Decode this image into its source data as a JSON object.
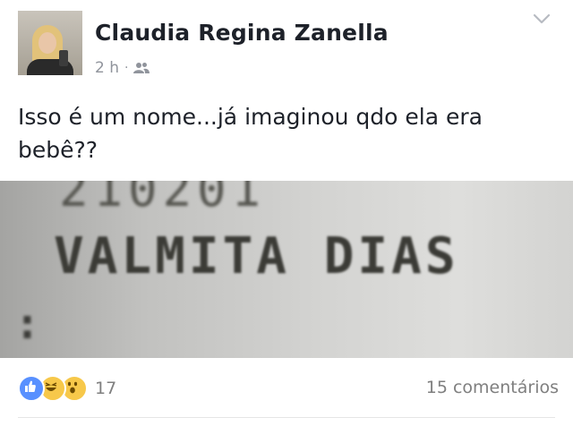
{
  "post": {
    "author": "Claudia Regina Zanella",
    "time": "2 h",
    "separator": "·",
    "text": "Isso é um nome...já imaginou qdo ela era\nbebê??",
    "photo": {
      "top_digits": "210201",
      "name": "VALMITA DIAS",
      "colon": ":"
    }
  },
  "footer": {
    "reaction_count": "17",
    "comments": "15 comentários"
  },
  "icons": {
    "audience": "friends-icon",
    "menu": "chevron-down-icon",
    "reactions": [
      "like-icon",
      "haha-icon",
      "wow-icon"
    ]
  },
  "colors": {
    "name": "#1d2129",
    "meta": "#90949c",
    "like": "#5890ff",
    "emoji": "#f7c84a"
  }
}
